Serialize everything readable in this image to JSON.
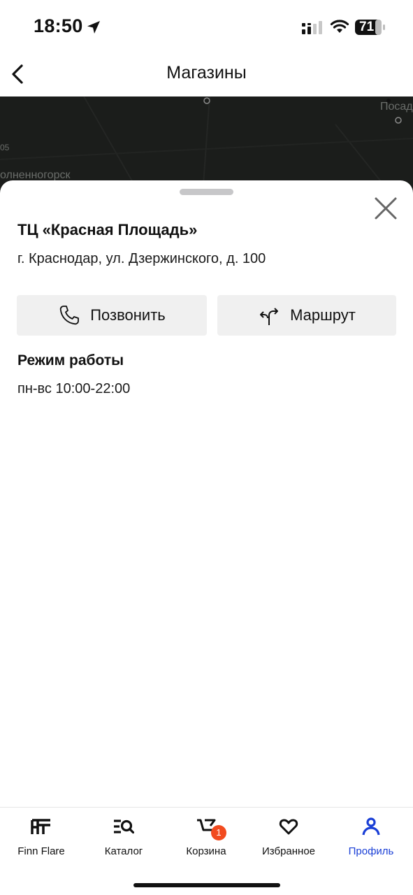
{
  "status_bar": {
    "time": "18:50",
    "battery": "71"
  },
  "nav": {
    "title": "Магазины"
  },
  "map": {
    "labels": [
      "Посад",
      "олненногорск",
      "05"
    ]
  },
  "store": {
    "name": "ТЦ «Красная Площадь»",
    "address": "г. Краснодар, ул. Дзержинского, д. 100"
  },
  "actions": {
    "call_label": "Позвонить",
    "route_label": "Маршрут"
  },
  "hours": {
    "heading": "Режим работы",
    "value": "пн-вс 10:00-22:00"
  },
  "tabs": [
    {
      "label": "Finn Flare",
      "icon": "finn-flare-logo-icon"
    },
    {
      "label": "Каталог",
      "icon": "catalog-search-icon"
    },
    {
      "label": "Корзина",
      "icon": "cart-icon",
      "badge": "1"
    },
    {
      "label": "Избранное",
      "icon": "heart-icon"
    },
    {
      "label": "Профиль",
      "icon": "profile-icon",
      "active": true
    }
  ],
  "colors": {
    "accent": "#1a3fd6",
    "badge": "#f24b1f",
    "button_bg": "#f0f0f0",
    "map_bg": "#1b1d1b"
  }
}
